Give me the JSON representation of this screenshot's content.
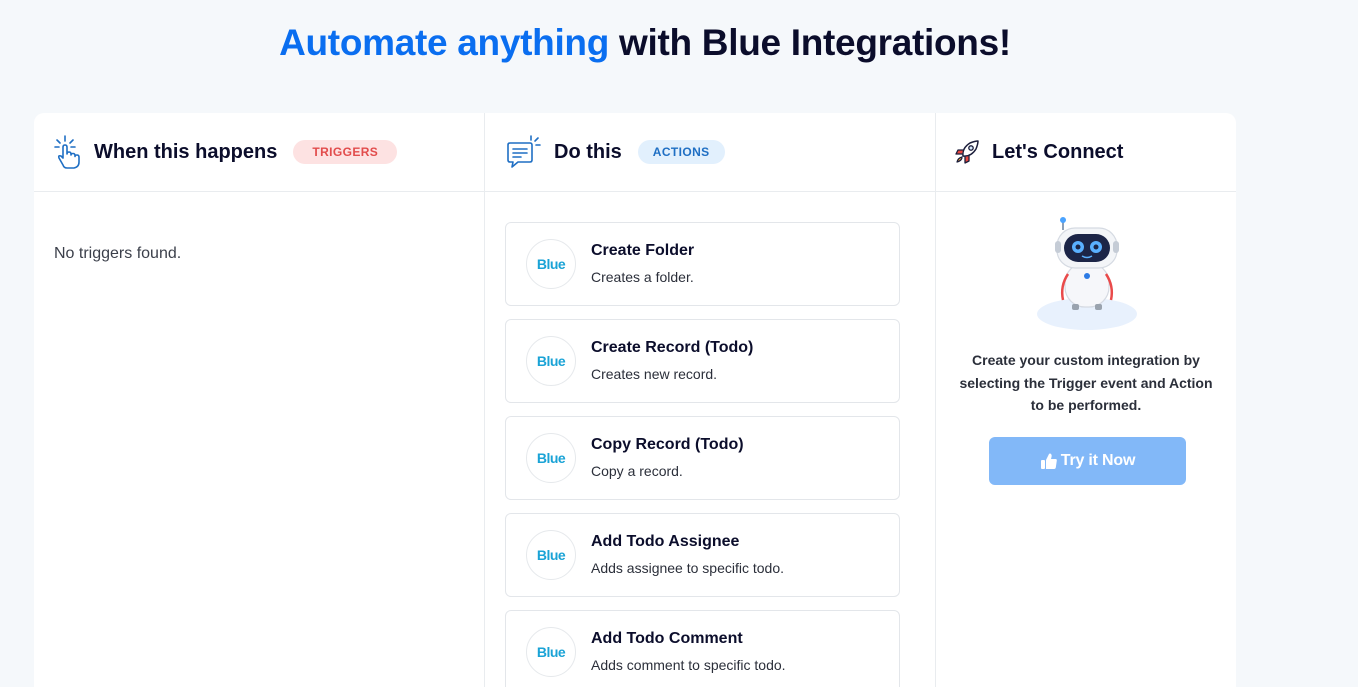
{
  "hero": {
    "accent": "Automate anything",
    "rest": " with Blue Integrations!"
  },
  "triggers": {
    "icon": "tap-hand-icon",
    "title": "When this happens",
    "badge": "TRIGGERS",
    "empty_text": "No triggers found."
  },
  "actions": {
    "icon": "chat-bubble-icon",
    "title": "Do this",
    "badge": "ACTIONS",
    "items": [
      {
        "logo": "Blue",
        "title": "Create Folder",
        "desc": "Creates a folder."
      },
      {
        "logo": "Blue",
        "title": "Create Record (Todo)",
        "desc": "Creates new record."
      },
      {
        "logo": "Blue",
        "title": "Copy Record (Todo)",
        "desc": "Copy a record."
      },
      {
        "logo": "Blue",
        "title": "Add Todo Assignee",
        "desc": "Adds assignee to specific todo."
      },
      {
        "logo": "Blue",
        "title": "Add Todo Comment",
        "desc": "Adds comment to specific todo."
      }
    ]
  },
  "connect": {
    "icon": "rocket-icon",
    "title": "Let's Connect",
    "description": "Create your custom integration by selecting the Trigger event and Action to be performed.",
    "button_label": "Try it Now",
    "button_icon": "thumbs-up-icon"
  },
  "colors": {
    "accent": "#0a6ef0",
    "trigger_badge_bg": "#fde2e2",
    "trigger_badge_text": "#e24c4c",
    "action_badge_bg": "#e2f0fd",
    "action_badge_text": "#1f6fc4",
    "button_bg": "#82b8f8",
    "logo_text": "#1aa3d6"
  }
}
